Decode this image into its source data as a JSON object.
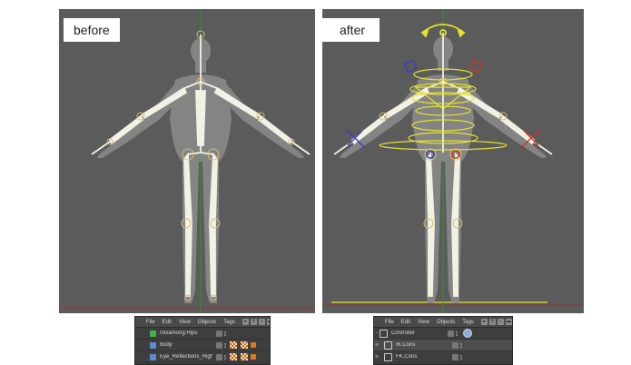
{
  "panels": {
    "before": {
      "label": "before"
    },
    "after": {
      "label": "after"
    }
  },
  "object_manager": {
    "menus": [
      "File",
      "Edit",
      "View",
      "Objects",
      "Tags"
    ],
    "before_rows": [
      {
        "name": "mixamorig:Hips",
        "icon": "joint-icon",
        "tags": []
      },
      {
        "name": "Body",
        "icon": "mesh-icon",
        "tags": [
          "checker",
          "checker",
          "orange"
        ]
      },
      {
        "name": "Eye_Reflections_Right",
        "icon": "mesh-icon",
        "tags": [
          "checker",
          "checker",
          "orange"
        ]
      }
    ],
    "after_rows": [
      {
        "name": "Controller",
        "icon": "null-icon",
        "tags": [
          "blue-python"
        ]
      },
      {
        "name": "IK.Cons",
        "icon": "null-icon",
        "tags": []
      },
      {
        "name": "FK.Cons",
        "icon": "null-icon",
        "tags": []
      }
    ]
  },
  "colors": {
    "viewport_bg": "#5b5b5b",
    "bone": "#f2f2e4",
    "joint_ring": "#d9bb72",
    "controller_yellow": "#e4e22c",
    "ik_blue": "#3d3cc4",
    "ik_red": "#c9372c",
    "axis_green": "#27a327",
    "axis_red": "#a22c2c"
  }
}
